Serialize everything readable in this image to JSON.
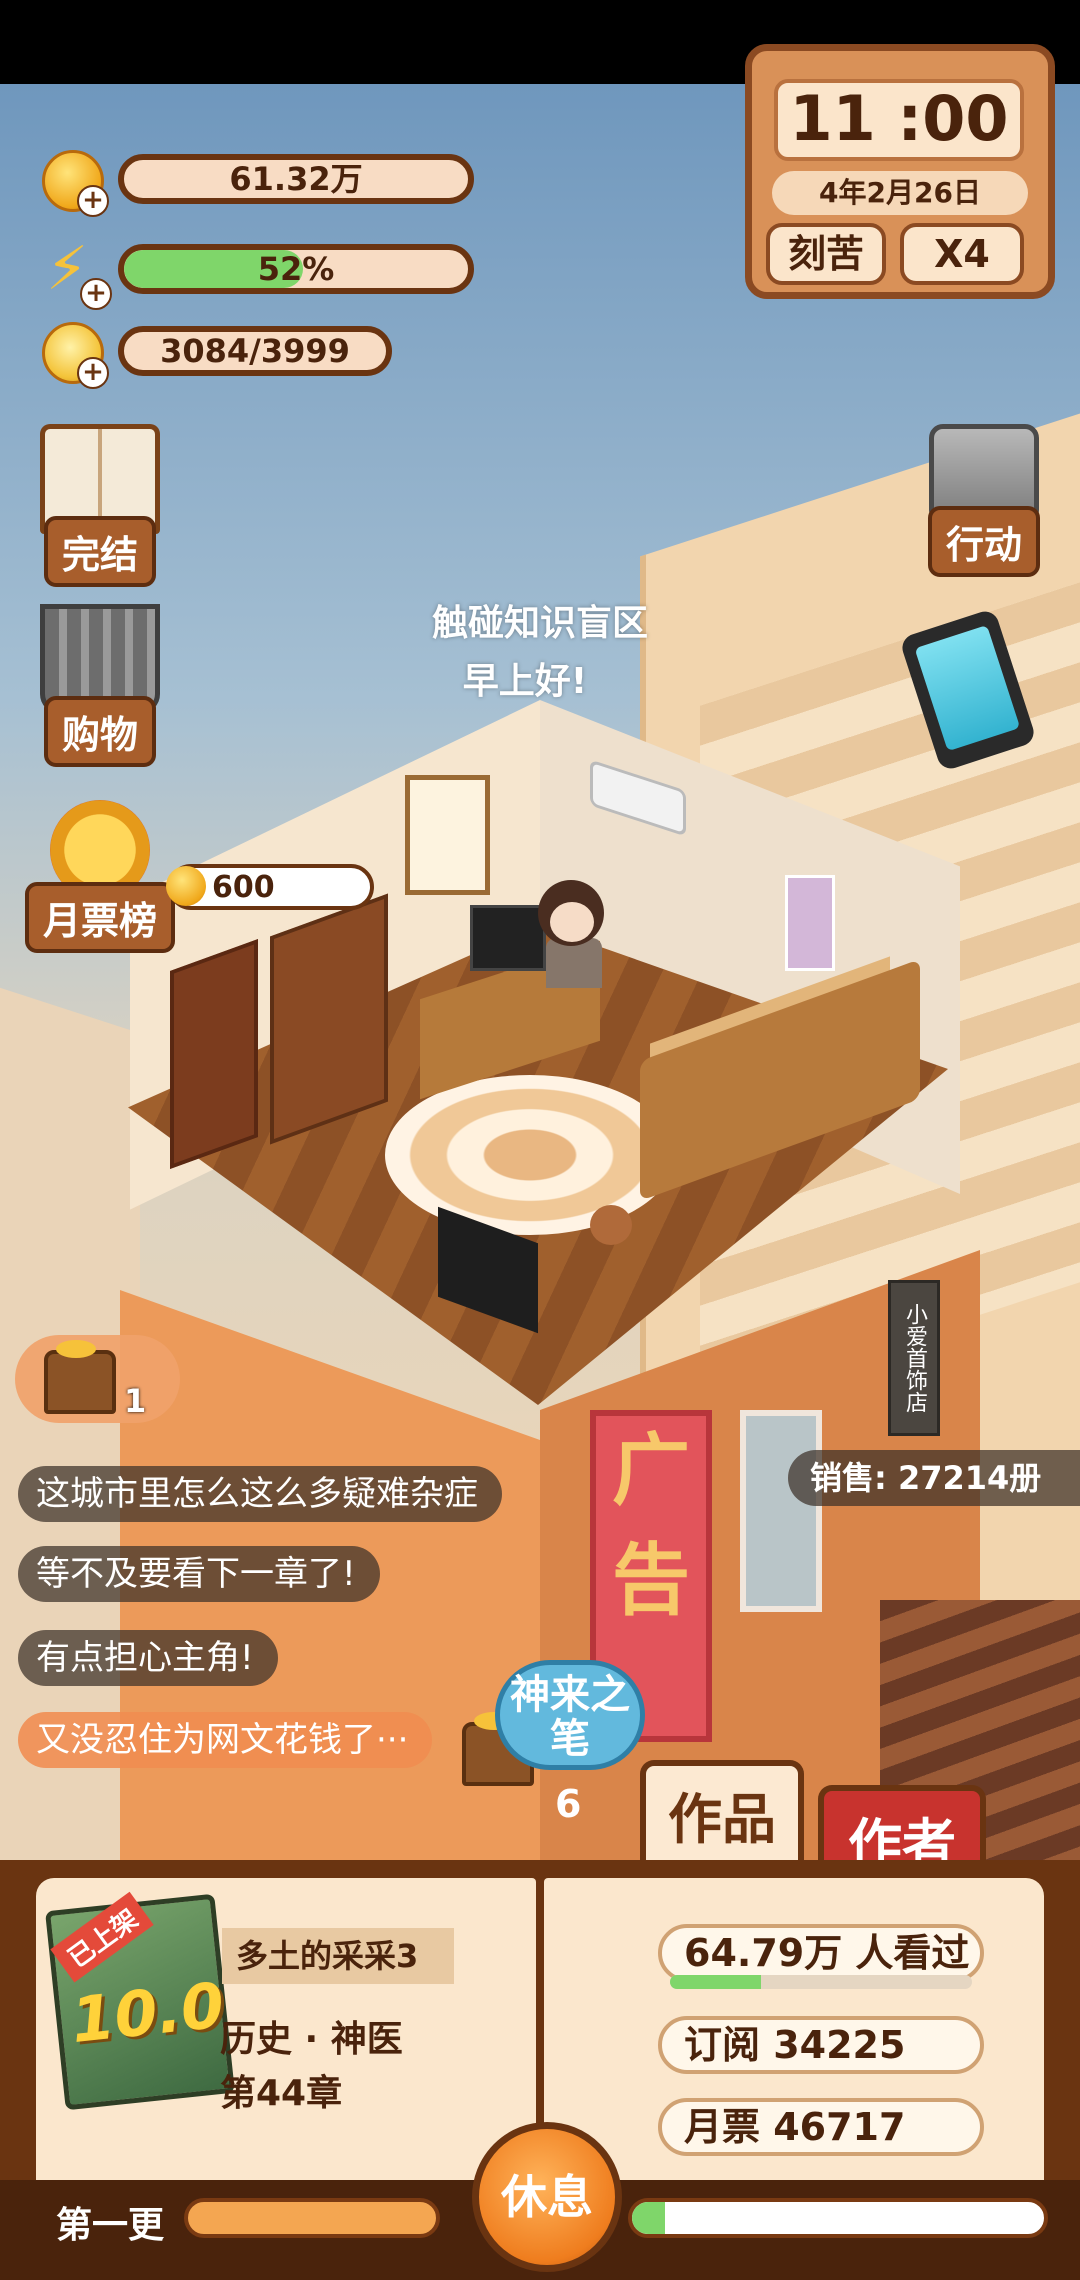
{
  "resources": {
    "coins": "61.32万",
    "energy_text": "52%",
    "energy_percent": 52,
    "ideas": "3084/3999"
  },
  "clock": {
    "time": "11 :00",
    "date": "4年2月26日",
    "mode": "刻苦",
    "speed": "X4"
  },
  "side_menu": {
    "finish": "完结",
    "shopping": "购物",
    "monthly_rank": "月票榜",
    "action": "行动"
  },
  "vote_reward": "600",
  "float_messages": [
    "触碰知识盲区",
    "早上好!"
  ],
  "room_sign": "小爱首饰店",
  "banner_text": "广告",
  "chest": {
    "count": "1"
  },
  "comments": [
    "这城市里怎么这么多疑难杂症",
    "等不及要看下一章了!",
    "有点担心主角!",
    "又没忍住为网文花钱了···"
  ],
  "sales": "销售: 27214册",
  "skill": {
    "label": "神来之笔",
    "count": "6"
  },
  "tabs": {
    "works": "作品",
    "author": "作者"
  },
  "novel": {
    "status": "已上架",
    "score": "10.0",
    "title": "多土的采采3",
    "genre": "历史 · 神医",
    "chapter": "第44章"
  },
  "stats": {
    "views": "64.79万 人看过",
    "views_progress": 0.3,
    "subscriptions": "订阅  34225",
    "monthly_votes": "月票  46717"
  },
  "footer": {
    "update_label": "第一更",
    "rest_button": "休息",
    "update_progress": 1.0,
    "rest_progress": 0.08
  }
}
